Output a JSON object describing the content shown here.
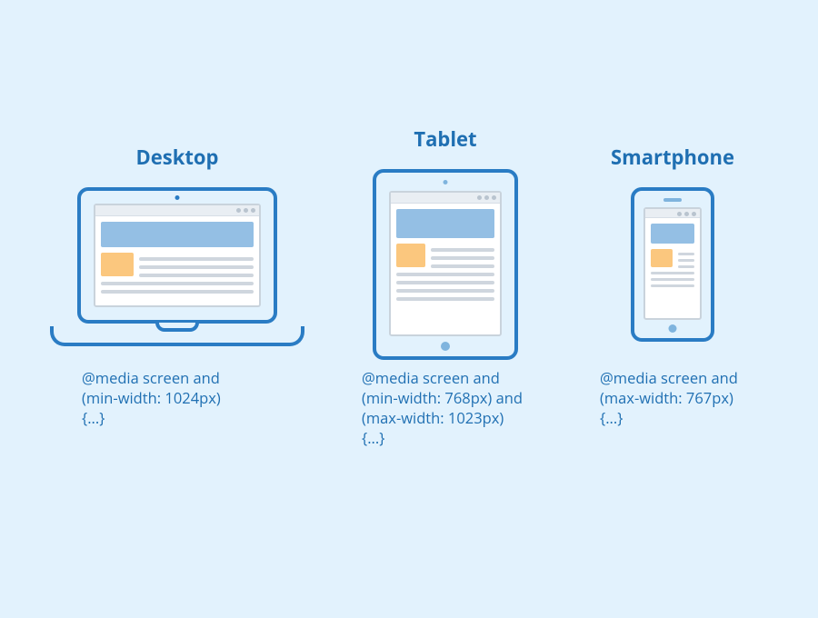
{
  "devices": {
    "desktop": {
      "title": "Desktop",
      "code": "@media screen and\n(min-width: 1024px)\n{...}"
    },
    "tablet": {
      "title": "Tablet",
      "code": "@media screen and\n(min-width: 768px) and\n(max-width: 1023px)\n{...}"
    },
    "smartphone": {
      "title": "Smartphone",
      "code": "@media screen and\n(max-width: 767px)\n{...}"
    }
  },
  "colors": {
    "background": "#e2f2fd",
    "stroke": "#2a7cc4",
    "heroBlue": "#94bfe4",
    "accentOrange": "#fbc77e",
    "textLine": "#cfd6de",
    "label": "#1f6fb2"
  }
}
